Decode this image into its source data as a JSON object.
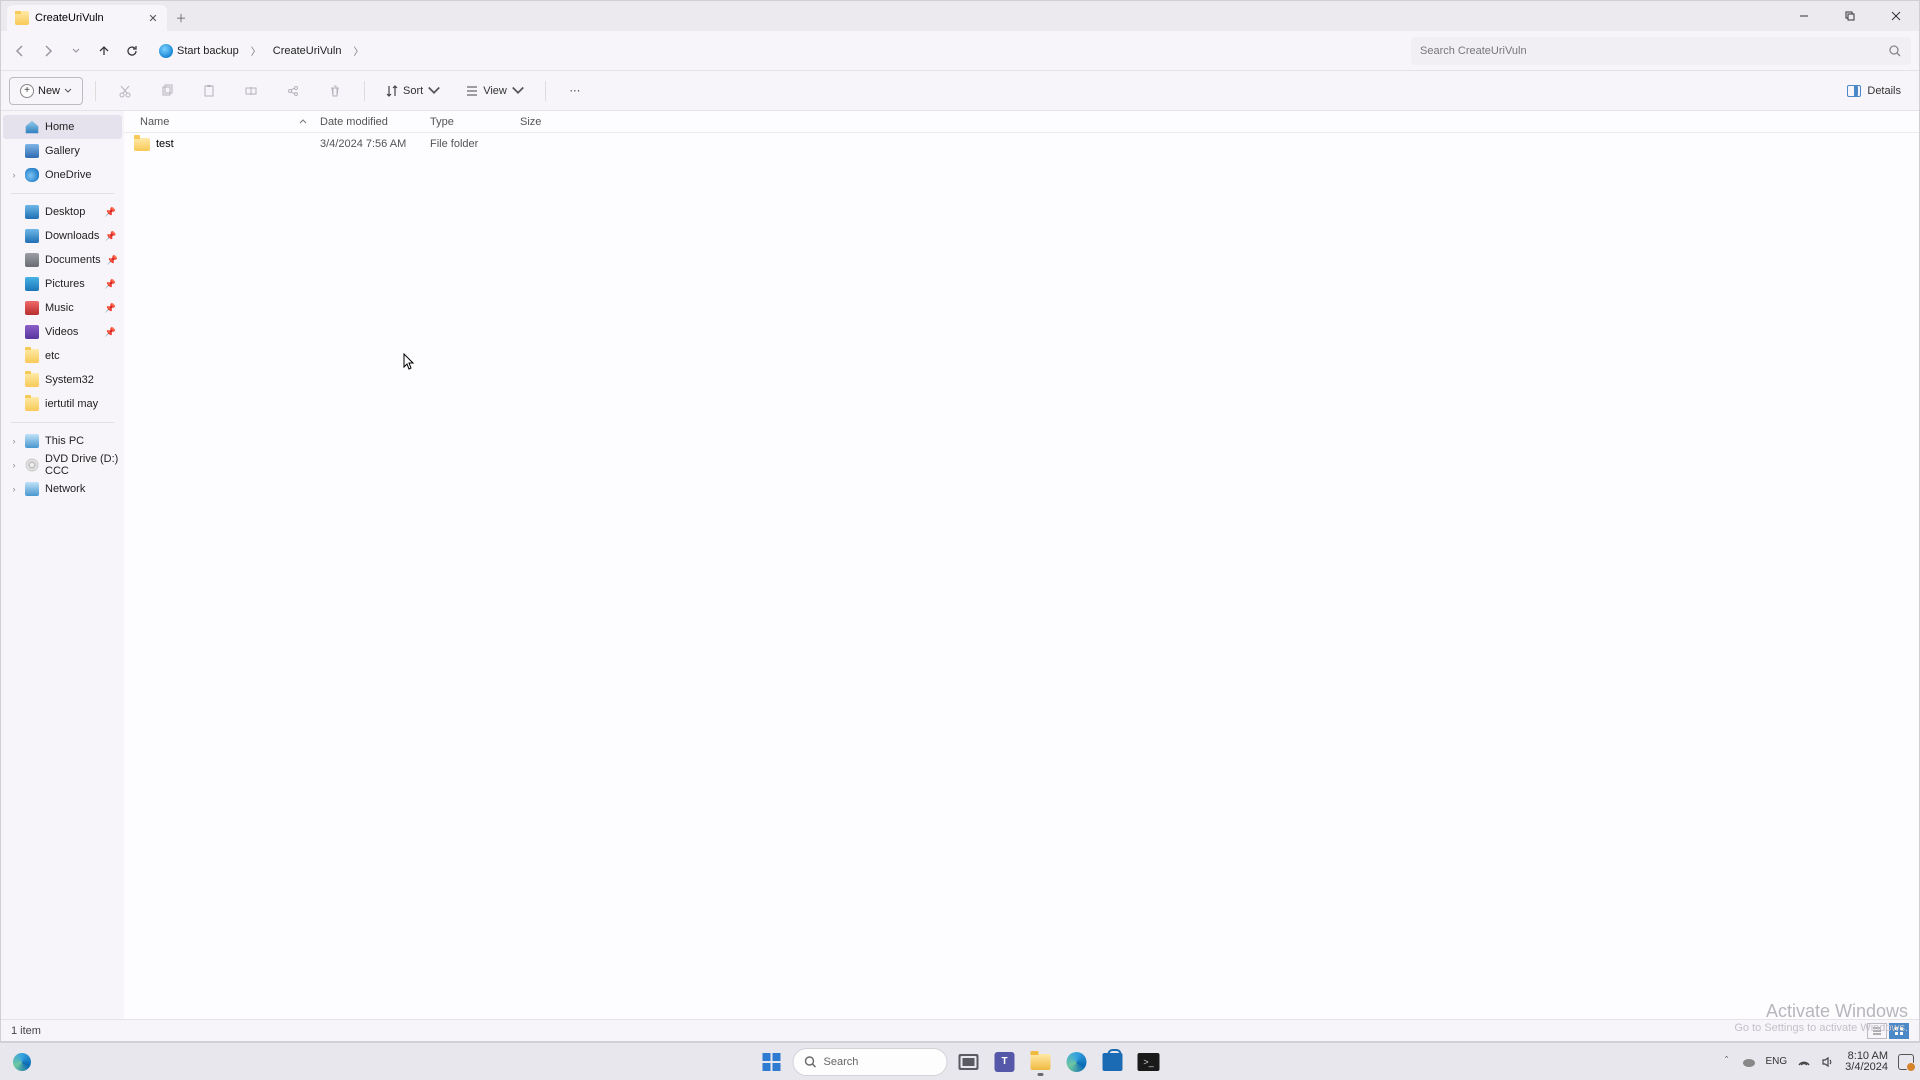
{
  "tab": {
    "title": "CreateUriVuln"
  },
  "breadcrumb": {
    "root": "Start backup",
    "current": "CreateUriVuln"
  },
  "search": {
    "placeholder": "Search CreateUriVuln"
  },
  "toolbar": {
    "new": "New",
    "sort": "Sort",
    "view": "View",
    "details": "Details"
  },
  "columns": {
    "name": "Name",
    "date": "Date modified",
    "type": "Type",
    "size": "Size"
  },
  "rows": [
    {
      "name": "test",
      "date": "3/4/2024 7:56 AM",
      "type": "File folder",
      "size": ""
    }
  ],
  "nav": {
    "home": "Home",
    "gallery": "Gallery",
    "onedrive": "OneDrive",
    "desktop": "Desktop",
    "downloads": "Downloads",
    "documents": "Documents",
    "pictures": "Pictures",
    "music": "Music",
    "videos": "Videos",
    "etc": "etc",
    "system32": "System32",
    "iertutil": "iertutil may",
    "thispc": "This PC",
    "dvd": "DVD Drive (D:) CCC",
    "network": "Network"
  },
  "status": {
    "count": "1 item"
  },
  "watermark": {
    "line1": "Activate Windows",
    "line2": "Go to Settings to activate Windows."
  },
  "taskbar": {
    "search": "Search",
    "clock": {
      "time": "8:10 AM",
      "date": "3/4/2024"
    }
  }
}
